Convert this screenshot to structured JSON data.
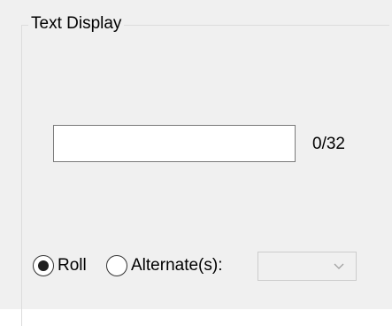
{
  "group": {
    "title": "Text Display"
  },
  "text_input": {
    "value": "",
    "placeholder": ""
  },
  "char_count": "0/32",
  "mode": {
    "selected": "roll",
    "options": [
      {
        "id": "roll",
        "label": "Roll",
        "checked": true
      },
      {
        "id": "alternate",
        "label": "Alternate(s):",
        "checked": false
      }
    ]
  },
  "alternate_select": {
    "selected_value": "",
    "enabled": false
  },
  "icons": {
    "dropdown": "chevron-down-icon",
    "radio_selected": "radio-selected-icon",
    "radio_unselected": "radio-unselected-icon"
  },
  "colors": {
    "panel_background": "#f0f0f0",
    "input_background": "#ffffff",
    "input_border": "#7a7a7a",
    "group_border": "#dcdcdc",
    "disabled_text": "#8a8a8a"
  }
}
